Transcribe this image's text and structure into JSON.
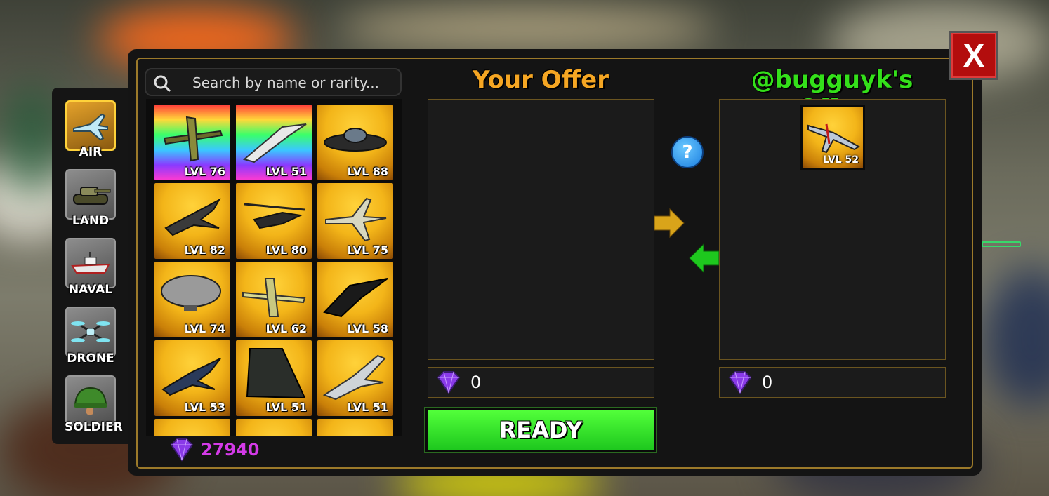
{
  "search": {
    "placeholder": "Search by name or rarity..."
  },
  "categories": [
    {
      "label": "AIR",
      "icon": "jet-icon",
      "active": true
    },
    {
      "label": "LAND",
      "icon": "tank-icon",
      "active": false
    },
    {
      "label": "NAVAL",
      "icon": "ship-icon",
      "active": false
    },
    {
      "label": "DRONE",
      "icon": "drone-icon",
      "active": false
    },
    {
      "label": "SOLDIER",
      "icon": "helmet-icon",
      "active": false
    }
  ],
  "inventory": [
    {
      "level": "LVL 76",
      "rarity": "rainbow",
      "icon": "cargo-plane-icon"
    },
    {
      "level": "LVL 51",
      "rarity": "rainbow",
      "icon": "stealth-jet-icon"
    },
    {
      "level": "LVL 88",
      "rarity": "gold",
      "icon": "ufo-icon"
    },
    {
      "level": "LVL 82",
      "rarity": "gold",
      "icon": "fighter-jet-icon"
    },
    {
      "level": "LVL 80",
      "rarity": "gold",
      "icon": "helicopter-icon"
    },
    {
      "level": "LVL 75",
      "rarity": "gold",
      "icon": "fighter-jet-icon"
    },
    {
      "level": "LVL 74",
      "rarity": "gold",
      "icon": "blimp-icon"
    },
    {
      "level": "LVL 62",
      "rarity": "gold",
      "icon": "cargo-plane-icon"
    },
    {
      "level": "LVL 58",
      "rarity": "gold",
      "icon": "stealth-jet-icon"
    },
    {
      "level": "LVL 53",
      "rarity": "gold",
      "icon": "fighter-jet-icon"
    },
    {
      "level": "LVL 51",
      "rarity": "gold",
      "icon": "stealth-bomber-icon"
    },
    {
      "level": "LVL 51",
      "rarity": "gold",
      "icon": "fighter-jet-icon"
    }
  ],
  "gems_total": "27940",
  "your_offer": {
    "title": "Your Offer",
    "gems": "0"
  },
  "their_offer": {
    "title": "@bugguyk's Offer",
    "gems": "0",
    "items": [
      {
        "level": "LVL 52",
        "icon": "propeller-plane-icon"
      }
    ]
  },
  "ready_label": "READY",
  "help_label": "?",
  "close_label": "X",
  "colors": {
    "your_title": "#f5a623",
    "their_title": "#34e01a",
    "gem": "#d43ae8",
    "ready": "#2ee02a"
  }
}
